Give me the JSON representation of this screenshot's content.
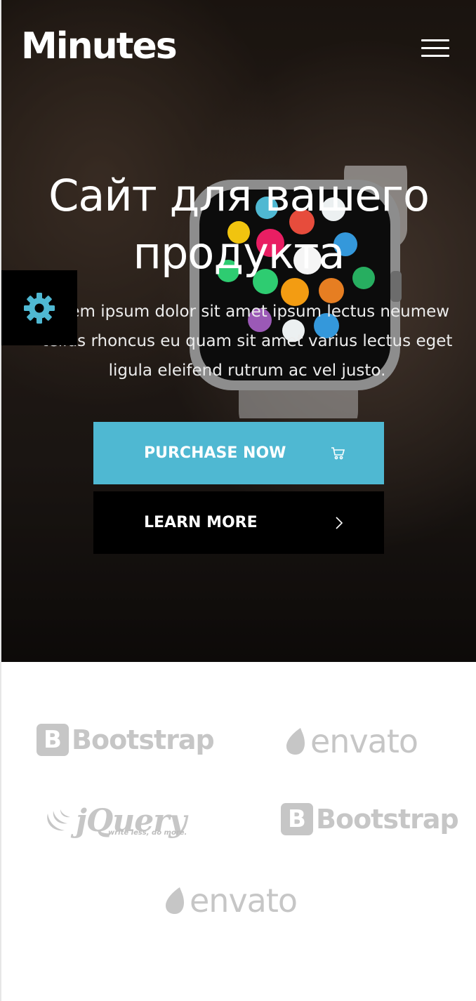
{
  "brand": {
    "logo": "Minutes"
  },
  "nav": {
    "menu_icon": "hamburger-menu-icon"
  },
  "hero": {
    "title": "Сайт для вашего продукта",
    "description": "Lorem ipsum dolor sit amet ipsum lectus neumew tellus rhoncus eu quam sit amet varius lectus eget ligula eleifend rutrum ac vel justo.",
    "purchase_button": {
      "label": "PURCHASE NOW",
      "icon": "cart-icon"
    },
    "learn_button": {
      "label": "LEARN MORE",
      "icon": "chevron-right-icon"
    }
  },
  "settings": {
    "icon": "gear-icon"
  },
  "partners": [
    {
      "name": "Bootstrap",
      "logo": "B"
    },
    {
      "name": "envato"
    },
    {
      "name": "jQuery",
      "tagline": "write less, do more."
    },
    {
      "name": "Bootstrap",
      "logo": "B"
    },
    {
      "name": "envato"
    }
  ],
  "colors": {
    "accent": "#4fb8d2",
    "dark_button": "#000000",
    "logo_gray": "#c6c6c6"
  }
}
